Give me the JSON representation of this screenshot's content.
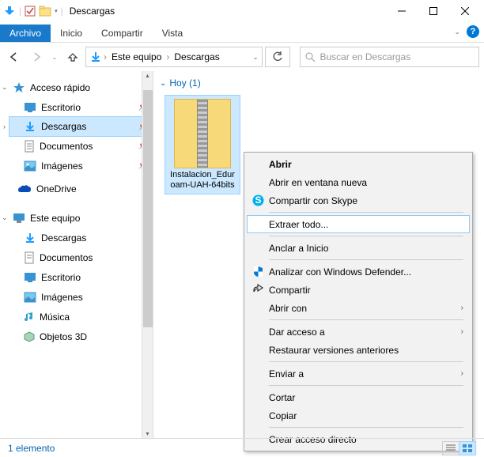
{
  "window": {
    "title": "Descargas"
  },
  "ribbon": {
    "tabs": [
      "Archivo",
      "Inicio",
      "Compartir",
      "Vista"
    ]
  },
  "breadcrumb": {
    "parts": [
      "Este equipo",
      "Descargas"
    ]
  },
  "search": {
    "placeholder": "Buscar en Descargas"
  },
  "nav": {
    "quick_access": "Acceso rápido",
    "quick_items": [
      {
        "label": "Escritorio",
        "icon": "desktop"
      },
      {
        "label": "Descargas",
        "icon": "downloads",
        "selected": true
      },
      {
        "label": "Documentos",
        "icon": "documents"
      },
      {
        "label": "Imágenes",
        "icon": "pictures"
      }
    ],
    "onedrive": "OneDrive",
    "this_pc": "Este equipo",
    "pc_items": [
      {
        "label": "Descargas",
        "icon": "downloads"
      },
      {
        "label": "Documentos",
        "icon": "documents"
      },
      {
        "label": "Escritorio",
        "icon": "desktop"
      },
      {
        "label": "Imágenes",
        "icon": "pictures"
      },
      {
        "label": "Música",
        "icon": "music"
      },
      {
        "label": "Objetos 3D",
        "icon": "objects3d"
      }
    ]
  },
  "content": {
    "group_header": "Hoy (1)",
    "file": {
      "name": "Instalacion_Eduroam-UAH-64bits"
    }
  },
  "context_menu": [
    {
      "label": "Abrir",
      "bold": true
    },
    {
      "label": "Abrir en ventana nueva"
    },
    {
      "label": "Compartir con Skype",
      "icon": "skype"
    },
    {
      "sep": true
    },
    {
      "label": "Extraer todo...",
      "highlighted": true
    },
    {
      "sep": true
    },
    {
      "label": "Anclar a Inicio"
    },
    {
      "sep": true
    },
    {
      "label": "Analizar con Windows Defender...",
      "icon": "defender"
    },
    {
      "label": "Compartir",
      "icon": "share"
    },
    {
      "label": "Abrir con",
      "submenu": true
    },
    {
      "sep": true
    },
    {
      "label": "Dar acceso a",
      "submenu": true
    },
    {
      "label": "Restaurar versiones anteriores"
    },
    {
      "sep": true
    },
    {
      "label": "Enviar a",
      "submenu": true
    },
    {
      "sep": true
    },
    {
      "label": "Cortar"
    },
    {
      "label": "Copiar"
    },
    {
      "sep": true
    },
    {
      "label": "Crear acceso directo"
    }
  ],
  "status": {
    "text": "1 elemento"
  }
}
